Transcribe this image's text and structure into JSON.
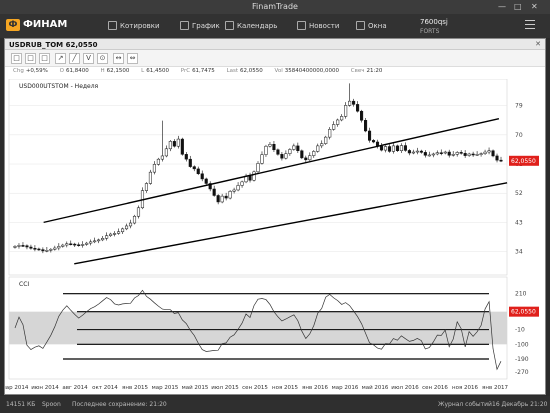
{
  "window": {
    "title": "FinamTrade",
    "controls": [
      "—",
      "□",
      "✕"
    ]
  },
  "topbar": {
    "logo": "ФИНАМ",
    "items": [
      {
        "label": "Котировки",
        "icon": "quotes-icon"
      },
      {
        "label": "График",
        "icon": "chart-icon"
      },
      {
        "label": "Календарь",
        "icon": "calendar-icon"
      },
      {
        "label": "Новости",
        "icon": "news-icon"
      },
      {
        "label": "Окна",
        "icon": "windows-icon"
      }
    ],
    "account": {
      "id": "7600qsj",
      "market": "FORTS"
    }
  },
  "chart_window": {
    "title": "USDRUB_TOM 62,0550",
    "close": "✕",
    "tools": [
      "□",
      "□",
      "□",
      "↗",
      "╱",
      "V",
      "⊙",
      "↔",
      "⇔"
    ],
    "info": [
      {
        "k": "Chg",
        "v": "+0,59%"
      },
      {
        "k": "O",
        "v": "61,8400"
      },
      {
        "k": "H",
        "v": "62,1500"
      },
      {
        "k": "L",
        "v": "61,4500"
      },
      {
        "k": "PrC",
        "v": "61,7475"
      },
      {
        "k": "Last",
        "v": "62,0550"
      },
      {
        "k": "Vol",
        "v": "35840400000,0000"
      },
      {
        "k": "Свеч",
        "v": "21:20"
      }
    ],
    "main_legend": "USD000UTSTOM - Неделя",
    "sub_legend": "CCI",
    "current_price": "62,0550",
    "current_cci": "62,0550"
  },
  "chart_data": [
    {
      "type": "candlestick",
      "title": "USD000UTSTOM - Неделя",
      "ylim": [
        28,
        86
      ],
      "y_ticks": [
        34,
        43,
        52,
        61,
        70,
        79
      ],
      "x_labels": [
        "мар 2014",
        "июн 2014",
        "авг 2014",
        "окт 2014",
        "янв 2015",
        "мар 2015",
        "май 2015",
        "июл 2015",
        "сен 2015",
        "ноя 2015",
        "янв 2016",
        "мар 2016",
        "май 2016",
        "июл 2016",
        "сен 2016",
        "ноя 2016",
        "янв 2017"
      ],
      "close": [
        35.6,
        35.9,
        35.8,
        35.4,
        35.0,
        34.8,
        34.6,
        34.2,
        34.4,
        34.7,
        35.1,
        35.6,
        36.0,
        36.4,
        36.3,
        36.1,
        35.9,
        36.2,
        36.6,
        37.0,
        37.3,
        37.6,
        38.1,
        38.9,
        39.4,
        39.6,
        40.1,
        41.0,
        41.9,
        42.8,
        44.9,
        47.5,
        52.8,
        55.0,
        58.5,
        60.9,
        62.5,
        63.5,
        65.7,
        68.0,
        66.5,
        68.7,
        64.0,
        62.5,
        60.2,
        59.5,
        58.0,
        56.4,
        55.0,
        53.3,
        51.3,
        49.3,
        51.1,
        50.5,
        52.6,
        53.0,
        54.4,
        55.5,
        57.3,
        56.0,
        58.6,
        61.2,
        63.9,
        66.5,
        67.1,
        65.4,
        64.0,
        62.8,
        64.2,
        65.5,
        66.6,
        65.1,
        62.9,
        62.3,
        63.6,
        64.9,
        66.6,
        67.3,
        69.3,
        71.7,
        73.2,
        74.6,
        75.7,
        79.1,
        80.4,
        79.4,
        77.3,
        74.5,
        71.2,
        68.3,
        67.8,
        66.5,
        65.3,
        66.4,
        64.9,
        66.6,
        65.1,
        66.7,
        65.2,
        64.4,
        64.7,
        65.0,
        64.6,
        63.7,
        63.8,
        64.1,
        64.5,
        64.4,
        64.7,
        63.7,
        64.0,
        64.6,
        64.3,
        63.6,
        64.1,
        63.9,
        64.0,
        64.2,
        64.7,
        65.1,
        63.5,
        62.2,
        62.0
      ],
      "channel_upper": [
        [
          15,
          43
        ],
        [
          238,
          75
        ]
      ],
      "channel_lower": [
        [
          30,
          30.2
        ],
        [
          242,
          55.2
        ]
      ]
    },
    {
      "type": "line",
      "title": "CCI",
      "ylim": [
        -300,
        300
      ],
      "y_ticks": [
        210,
        100,
        -10,
        -100,
        -190,
        -270
      ],
      "levels": [
        210,
        100,
        -10,
        -100,
        -190
      ]
    }
  ],
  "status": {
    "time_left": "14151 КБ",
    "server": "Spoon",
    "saved": "Последнее сохранение: 21:20",
    "journal": "Журнал событий",
    "date": "16 Декабрь 21:20"
  }
}
